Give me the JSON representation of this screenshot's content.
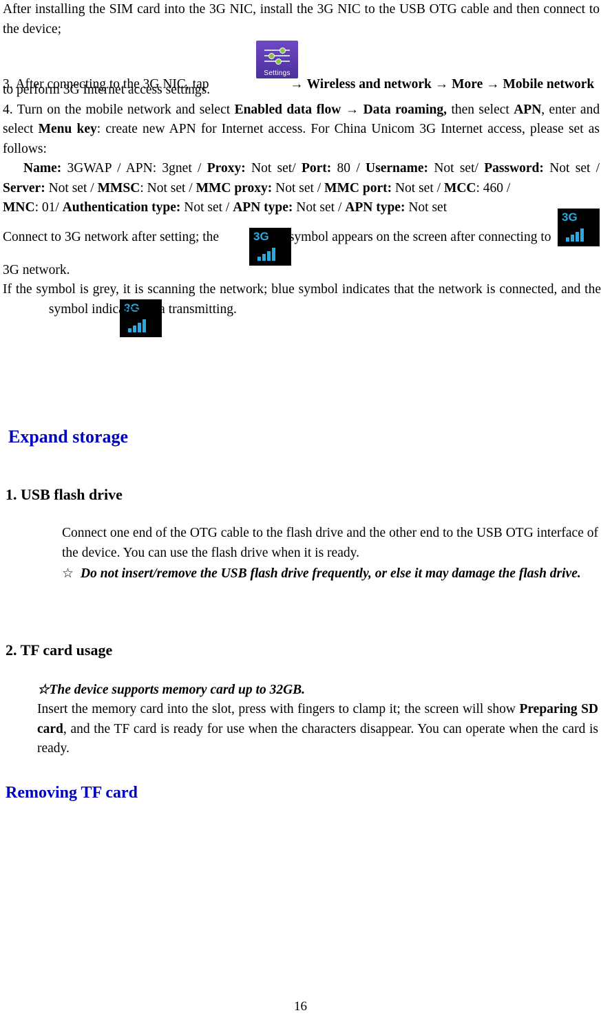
{
  "document": {
    "page_number": "16",
    "paragraphs": {
      "p_install": "After installing the SIM card into the 3G NIC, install the 3G NIC to the USB OTG cable and then connect to the device;",
      "p3_prefix": "3. After connecting to the 3G NIC, tap",
      "p3_arrow1": "→",
      "p3_wireless": "Wireless and network",
      "p3_arrow2": "→",
      "p3_more": "More",
      "p3_arrow3": "→",
      "p3_mobile": "Mobile network",
      "p3_suffix": "to perform 3G Internet access settings.",
      "p4_a": "4. Turn on the mobile network and select",
      "p4_enabled": "Enabled data flow",
      "p4_arrow": "→",
      "p4_roaming": "Data roaming,",
      "p4_b": "then select",
      "p4_apn": "APN",
      "p4_c": ", enter and select",
      "p4_menukey": "Menu key",
      "p4_d": ": create new APN for Internet access. For China Unicom 3G Internet access, please set as follows:",
      "apn": {
        "name_label": "Name:",
        "name_value": "3GWAP / APN: 3gnet /",
        "proxy_label": "Proxy:",
        "proxy_value": "Not set/",
        "port_label": "Port:",
        "port_value": "80 /",
        "username_label": "Username:",
        "username_value": "Not set/",
        "password_label": "Password:",
        "password_value": "Not set /",
        "server_label": "Server:",
        "server_value": "Not set /",
        "mmsc_label": "MMSC",
        "mmsc_value": ": Not set /",
        "mmcproxy_label": "MMC proxy:",
        "mmcproxy_value": "Not set /",
        "mmcport_label": "MMC port:",
        "mmcport_value": "Not set /",
        "mcc_label": "MCC",
        "mcc_value": ": 460 /",
        "mnc_label": "MNC",
        "mnc_value": ": 01/",
        "auth_label": "Authentication type:",
        "auth_value": "Not set /",
        "apntype1_label": "APN type:",
        "apntype1_value": "Not set /",
        "apntype2_label": "APN type:",
        "apntype2_value": "Not set"
      },
      "p_connect_a": "Connect to 3G network after setting; the",
      "p_connect_b": "symbol appears on the screen after connecting to",
      "p_connect_c": "3G network.",
      "p_grey_a": "If the symbol is grey, it is scanning the network; blue symbol indicates that the network is connected, and the",
      "p_grey_b": "symbol indicates data transmitting."
    },
    "headings": {
      "expand_storage": "Expand storage",
      "usb_flash_drive": "1. USB flash drive",
      "tf_card_usage": "2. TF card usage",
      "removing_tf_card": "Removing TF card"
    },
    "usb_section": {
      "para": "Connect one end of the OTG cable to the flash drive and the other end to the USB OTG interface of the device. You can use the flash drive when it is ready.",
      "note_glyph": "☆",
      "note": "Do not insert/remove the USB flash drive frequently, or else it may damage the flash drive."
    },
    "tf_section": {
      "note": "☆The device supports memory card up to 32GB.",
      "line_a": "Insert the memory card into the slot, press with fingers to clamp it; the screen will show",
      "bold_preparing": "Preparing SD card",
      "line_b": ", and the TF card is ready for use when the characters disappear. You can operate when the card is ready."
    },
    "icons": {
      "settings_caption": "Settings",
      "network_label": "3G"
    },
    "colors": {
      "heading_blue": "#0000c0",
      "icon_purple": "#5b37b0",
      "signal_blue": "#2aa9e0"
    }
  }
}
